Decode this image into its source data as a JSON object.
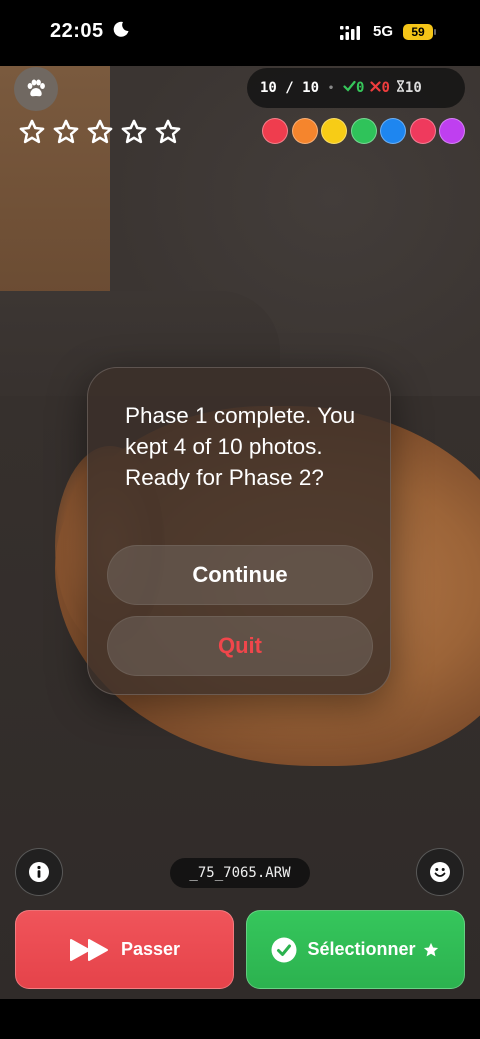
{
  "status_bar": {
    "time": "22:05",
    "network": "5G",
    "battery": "59",
    "battery_color": "#f5c518"
  },
  "header": {
    "paw_icon": "paw-icon",
    "rating_stars": 5,
    "counter": {
      "progress": "10 / 10",
      "separator": "•",
      "kept": "0",
      "rejected": "0",
      "pending": "10"
    },
    "color_labels": [
      "#ef3d4e",
      "#f5852d",
      "#f7cc16",
      "#2fc35a",
      "#1e86f0",
      "#ef3a5d",
      "#bf3ff0"
    ]
  },
  "dialog": {
    "message": "Phase 1 complete. You kept 4 of 10 photos. Ready for Phase 2?",
    "continue_label": "Continue",
    "quit_label": "Quit",
    "quit_color": "#f0464b"
  },
  "footer": {
    "filename": "_75_7065.ARW",
    "info_icon": "info-icon",
    "smile_icon": "smile-icon",
    "skip_label": "Passer",
    "select_label": "Sélectionner",
    "skip_color": "#e5434a",
    "select_color": "#2cb24f"
  }
}
